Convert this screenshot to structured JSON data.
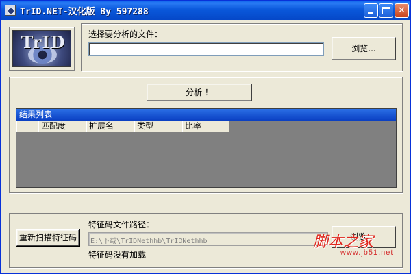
{
  "window": {
    "title": "TrID.NET-汉化版 By 597288"
  },
  "logo": {
    "text": "TrID"
  },
  "file_select": {
    "label": "选择要分析的文件：",
    "path_value": "",
    "browse_label": "浏览..."
  },
  "analyze": {
    "button_label": "分析 ！",
    "results_title": "结果列表",
    "columns": [
      "",
      "匹配度",
      "扩展名",
      "类型",
      "比率"
    ]
  },
  "signatures": {
    "rescan_label": "重新扫描特征码",
    "path_label": "特征码文件路径：",
    "path_value": "E:\\下载\\TrIDNethhb\\TrIDNethhb",
    "browse_label": "浏览",
    "status": "特征码没有加载"
  },
  "watermark": {
    "text": "脚本之家",
    "url": "www.jb51.net"
  },
  "colors": {
    "titlebar": "#0a58db",
    "face": "#ece9d8",
    "results_bg": "#808080",
    "watermark": "#e0261e"
  }
}
